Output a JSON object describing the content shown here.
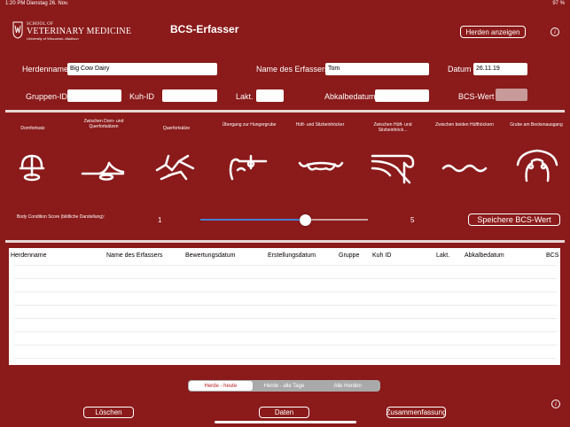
{
  "status_bar": {
    "left": "1:20 PM   Dienstag 26. Nov.",
    "right": "97 %"
  },
  "logo": {
    "small": "SCHOOL OF",
    "big": "VETERINARY MEDICINE",
    "sub": "University of Wisconsin–Madison"
  },
  "app_title": "BCS-Erfasser",
  "header_button": "Herden anzeigen",
  "info_symbol": "i",
  "form": {
    "herdenname_label": "Herdenname",
    "herdenname_value": "Big Cow Dairy",
    "erfasser_label": "Name des Erfassers",
    "erfasser_value": "Tom",
    "datum_label": "Datum",
    "datum_value": "26.11.19",
    "gruppen_label": "Gruppen-ID",
    "gruppen_value": "",
    "kuh_label": "Kuh-ID",
    "kuh_value": "",
    "lakt_label": "Lakt.",
    "lakt_value": "",
    "abkalb_label": "Abkalbedatum",
    "abkalb_value": "",
    "bcs_label": "BCS-Wert"
  },
  "sites": [
    {
      "label": "Dornfortsatz",
      "icon": "spinous-process-icon"
    },
    {
      "label": "Zwischen Dorn- und Querfortsätzen",
      "icon": "between-processes-icon"
    },
    {
      "label": "Querfortsätze",
      "icon": "transverse-process-icon"
    },
    {
      "label": "Übergang zur Hungergrube",
      "icon": "hunger-pit-icon"
    },
    {
      "label": "Hüft- und Sitzbeinhöcker",
      "icon": "hook-pin-icon"
    },
    {
      "label": "Zwischen Hüft- und Sitzbeinhöck...",
      "icon": "between-hook-pin-icon"
    },
    {
      "label": "Zwischen beiden Hüfthöckern",
      "icon": "between-hooks-icon"
    },
    {
      "label": "Grube am Beckenausgang",
      "icon": "tailhead-pit-icon"
    }
  ],
  "slider": {
    "caption": "Body Condition Score (bildliche Darstellung):",
    "min_label": "1",
    "max_label": "5",
    "min": 1,
    "max": 5,
    "value": 3.5
  },
  "save_button": "Speichere BCS-Wert",
  "table": {
    "columns": [
      "Herdenname",
      "Name des Erfassers",
      "Bewertungsdatum",
      "Erstellungsdatum",
      "Gruppe",
      "Kuh ID",
      "Lakt.",
      "Abkalbedatum",
      "BCS"
    ],
    "rows": []
  },
  "segments": [
    {
      "label": "Herde - heute",
      "active": true
    },
    {
      "label": "Herde - alle Tage",
      "active": false
    },
    {
      "label": "Alle Herden",
      "active": false
    }
  ],
  "bottom_buttons": {
    "delete": "Löschen",
    "data": "Daten",
    "summary": "Zusammenfassung"
  },
  "colors": {
    "background": "#8b1a1a",
    "accent_red": "#b51f1f",
    "slider_fill": "#4a7fd1"
  }
}
